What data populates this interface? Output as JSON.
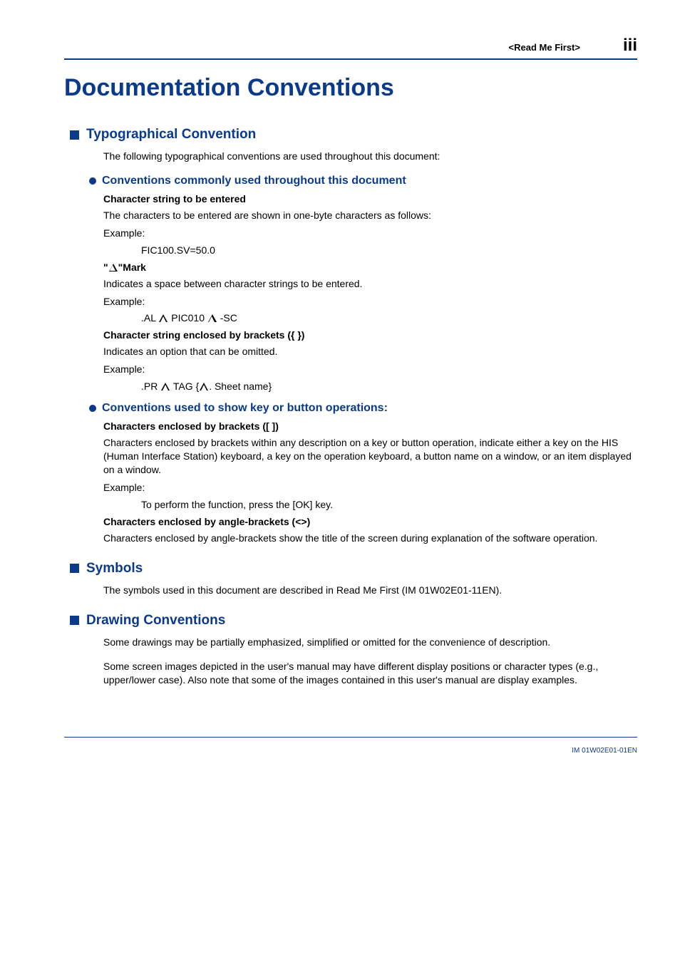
{
  "header": {
    "read_me_first": "<Read Me First>",
    "page_number": "iii"
  },
  "title": "Documentation Conventions",
  "s1": {
    "heading": "Typographical Convention",
    "intro": "The following typographical conventions are used throughout this document:",
    "sub1": {
      "heading": "Conventions commonly used throughout this document",
      "b1": {
        "h": "Character string to be entered",
        "p1": "The characters to be entered are shown in one-byte characters as follows:",
        "p2": "Example:",
        "code": "FIC100.SV=50.0"
      },
      "b2": {
        "h_pre": "\"",
        "h_post": "\"Mark",
        "p1": "Indicates a space between character strings to be entered.",
        "p2": "Example:",
        "code_pre": ".AL ",
        "code_mid": " PIC010 ",
        "code_post": " -SC"
      },
      "b3": {
        "h": "Character string enclosed by brackets ({ })",
        "p1": "Indicates an option that can be omitted.",
        "p2": "Example:",
        "code_pre": ".PR ",
        "code_mid": " TAG {",
        "code_post": ". Sheet name}"
      }
    },
    "sub2": {
      "heading": "Conventions used to show key or button operations:",
      "b1": {
        "h": "Characters enclosed by brackets ([ ])",
        "p1": "Characters enclosed by brackets within any description on a key or button operation, indicate either a key on the HIS (Human Interface Station) keyboard, a key on the operation keyboard, a button name on a window, or an item displayed on a window.",
        "p2": "Example:",
        "code": "To perform the function, press the [OK] key."
      },
      "b2": {
        "h": "Characters enclosed by angle-brackets (<>)",
        "p1": "Characters enclosed by angle-brackets show the title of the screen during explanation of the software operation."
      }
    }
  },
  "s2": {
    "heading": "Symbols",
    "p": "The symbols used in this document are described in Read Me First (IM 01W02E01-11EN)."
  },
  "s3": {
    "heading": "Drawing Conventions",
    "p1": "Some drawings may be partially emphasized, simplified or omitted for the convenience of description.",
    "p2": "Some screen images depicted in the user's manual may have different display positions or character types (e.g., upper/lower case). Also note that some of the images contained in this user's manual are display examples."
  },
  "footer": {
    "doc_id": "IM 01W02E01-01EN"
  }
}
